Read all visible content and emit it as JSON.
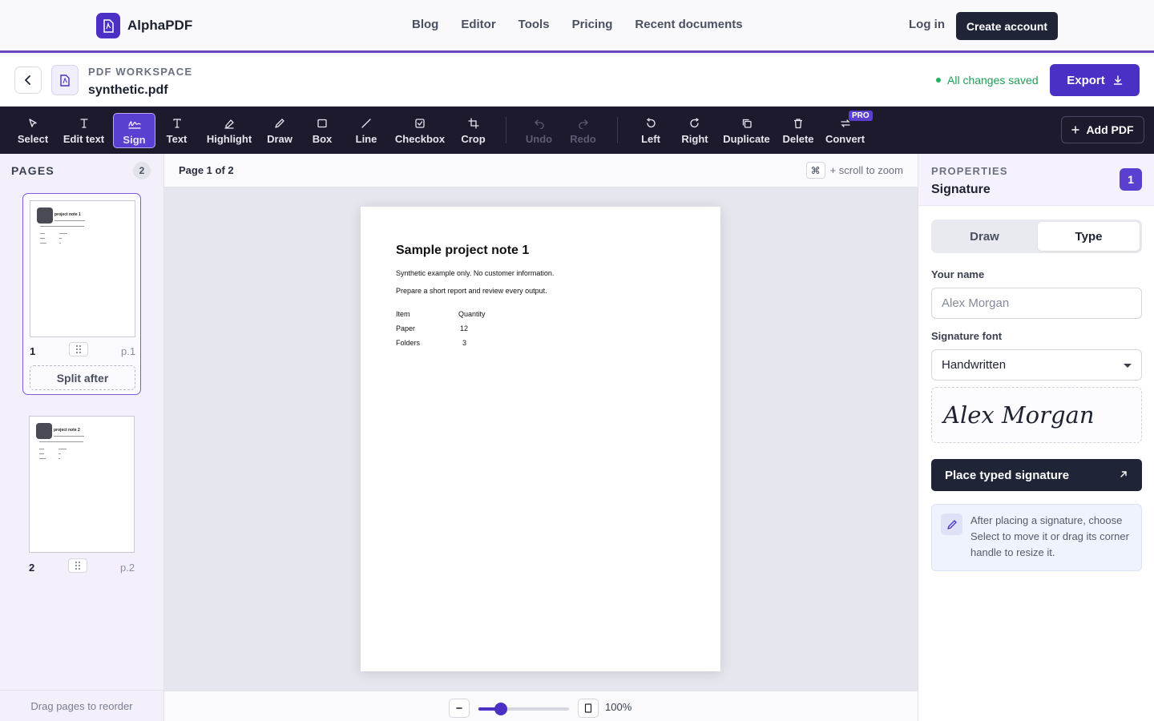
{
  "brand": {
    "name": "AlphaPDF"
  },
  "nav": {
    "links": [
      "Blog",
      "Editor",
      "Tools",
      "Pricing",
      "Recent documents"
    ],
    "login": "Log in",
    "create_account": "Create account"
  },
  "workspace": {
    "kicker": "PDF WORKSPACE",
    "filename": "synthetic.pdf",
    "save_status": "All changes saved",
    "export_label": "Export"
  },
  "toolbar": {
    "tools": [
      {
        "label": "Select",
        "icon": "cursor-icon"
      },
      {
        "label": "Edit text",
        "icon": "text-cursor-icon"
      },
      {
        "label": "Sign",
        "icon": "signature-icon",
        "active": true
      },
      {
        "label": "Text",
        "icon": "text-icon"
      },
      {
        "label": "Highlight",
        "icon": "highlighter-icon"
      },
      {
        "label": "Draw",
        "icon": "pencil-icon"
      },
      {
        "label": "Box",
        "icon": "square-icon"
      },
      {
        "label": "Line",
        "icon": "line-icon"
      },
      {
        "label": "Checkbox",
        "icon": "checkbox-icon"
      },
      {
        "label": "Crop",
        "icon": "crop-icon"
      }
    ],
    "history": [
      {
        "label": "Undo",
        "icon": "undo-icon",
        "disabled": true
      },
      {
        "label": "Redo",
        "icon": "redo-icon",
        "disabled": true
      }
    ],
    "page_tools": [
      {
        "label": "Left",
        "icon": "rotate-left-icon"
      },
      {
        "label": "Right",
        "icon": "rotate-right-icon"
      },
      {
        "label": "Duplicate",
        "icon": "copy-icon"
      },
      {
        "label": "Delete",
        "icon": "trash-icon"
      },
      {
        "label": "Convert",
        "icon": "convert-icon",
        "badge": "PRO"
      }
    ],
    "add_pdf": "Add PDF"
  },
  "pages": {
    "title": "PAGES",
    "count": "2",
    "items": [
      {
        "num": "1",
        "label": "p.1",
        "thumb_title": "project note 1",
        "selected": true
      },
      {
        "num": "2",
        "label": "p.2",
        "thumb_title": "project note 2",
        "selected": false
      }
    ],
    "split_after": "Split after",
    "footer": "Drag pages to reorder"
  },
  "canvas": {
    "page_indicator": "Page 1 of 2",
    "kbd": "⌘",
    "zoom_hint": "+ scroll to zoom",
    "zoom_level": "100%",
    "zoom_fraction": 0.25
  },
  "document": {
    "title": "Sample project note 1",
    "lines": [
      "Synthetic example only. No customer information.",
      "Prepare a short report and review every output."
    ],
    "table": {
      "headers": [
        "Item",
        "Quantity"
      ],
      "rows": [
        [
          "Paper",
          "12"
        ],
        [
          "Folders",
          "3"
        ]
      ]
    }
  },
  "properties": {
    "kicker": "PROPERTIES",
    "title": "Signature",
    "badge": "1",
    "modes": [
      "Draw",
      "Type"
    ],
    "active_mode": "Type",
    "name_label": "Your name",
    "name_placeholder": "Alex Morgan",
    "font_label": "Signature font",
    "font_value": "Handwritten",
    "preview": "Alex Morgan",
    "place_button": "Place typed signature",
    "tip": "After placing a signature, choose Select to move it or drag its corner handle to resize it."
  },
  "colors": {
    "accent": "#4c2fc4",
    "toolbar_bg": "#1d1a2e",
    "success": "#1f9d55"
  }
}
